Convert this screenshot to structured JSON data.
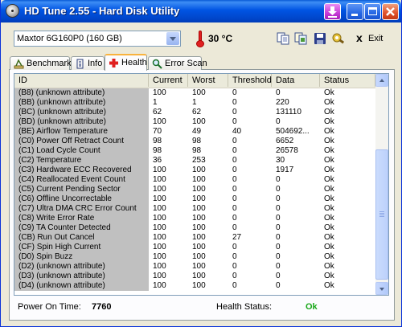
{
  "window": {
    "title": "HD Tune 2.55 - Hard Disk Utility"
  },
  "toolbar": {
    "drive": "Maxtor 6G160P0 (160 GB)",
    "temperature": "30 °C",
    "exit_label": "Exit",
    "exit_mnemonic": "x"
  },
  "tabs": [
    {
      "label": "Benchmark",
      "icon": "benchmark-icon"
    },
    {
      "label": "Info",
      "icon": "info-icon"
    },
    {
      "label": "Health",
      "icon": "health-cross-icon",
      "active": true
    },
    {
      "label": "Error Scan",
      "icon": "magnifier-icon"
    }
  ],
  "grid": {
    "columns": [
      "ID",
      "Current",
      "Worst",
      "Threshold",
      "Data",
      "Status"
    ],
    "rows": [
      {
        "id": "(B8) (unknown attribute)",
        "current": "100",
        "worst": "100",
        "threshold": "0",
        "data": "0",
        "status": "Ok"
      },
      {
        "id": "(BB) (unknown attribute)",
        "current": "1",
        "worst": "1",
        "threshold": "0",
        "data": "220",
        "status": "Ok"
      },
      {
        "id": "(BC) (unknown attribute)",
        "current": "62",
        "worst": "62",
        "threshold": "0",
        "data": "131110",
        "status": "Ok"
      },
      {
        "id": "(BD) (unknown attribute)",
        "current": "100",
        "worst": "100",
        "threshold": "0",
        "data": "0",
        "status": "Ok"
      },
      {
        "id": "(BE) Airflow Temperature",
        "current": "70",
        "worst": "49",
        "threshold": "40",
        "data": "504692...",
        "status": "Ok"
      },
      {
        "id": "(C0) Power Off Retract Count",
        "current": "98",
        "worst": "98",
        "threshold": "0",
        "data": "6652",
        "status": "Ok"
      },
      {
        "id": "(C1) Load Cycle Count",
        "current": "98",
        "worst": "98",
        "threshold": "0",
        "data": "26578",
        "status": "Ok"
      },
      {
        "id": "(C2) Temperature",
        "current": "36",
        "worst": "253",
        "threshold": "0",
        "data": "30",
        "status": "Ok"
      },
      {
        "id": "(C3) Hardware ECC Recovered",
        "current": "100",
        "worst": "100",
        "threshold": "0",
        "data": "1917",
        "status": "Ok"
      },
      {
        "id": "(C4) Reallocated Event Count",
        "current": "100",
        "worst": "100",
        "threshold": "0",
        "data": "0",
        "status": "Ok"
      },
      {
        "id": "(C5) Current Pending Sector",
        "current": "100",
        "worst": "100",
        "threshold": "0",
        "data": "0",
        "status": "Ok"
      },
      {
        "id": "(C6) Offline Uncorrectable",
        "current": "100",
        "worst": "100",
        "threshold": "0",
        "data": "0",
        "status": "Ok"
      },
      {
        "id": "(C7) Ultra DMA CRC Error Count",
        "current": "100",
        "worst": "100",
        "threshold": "0",
        "data": "0",
        "status": "Ok"
      },
      {
        "id": "(C8) Write Error Rate",
        "current": "100",
        "worst": "100",
        "threshold": "0",
        "data": "0",
        "status": "Ok"
      },
      {
        "id": "(C9) TA Counter Detected",
        "current": "100",
        "worst": "100",
        "threshold": "0",
        "data": "0",
        "status": "Ok"
      },
      {
        "id": "(CB) Run Out Cancel",
        "current": "100",
        "worst": "100",
        "threshold": "27",
        "data": "0",
        "status": "Ok"
      },
      {
        "id": "(CF) Spin High Current",
        "current": "100",
        "worst": "100",
        "threshold": "0",
        "data": "0",
        "status": "Ok"
      },
      {
        "id": "(D0) Spin Buzz",
        "current": "100",
        "worst": "100",
        "threshold": "0",
        "data": "0",
        "status": "Ok"
      },
      {
        "id": "(D2) (unknown attribute)",
        "current": "100",
        "worst": "100",
        "threshold": "0",
        "data": "0",
        "status": "Ok"
      },
      {
        "id": "(D3) (unknown attribute)",
        "current": "100",
        "worst": "100",
        "threshold": "0",
        "data": "0",
        "status": "Ok"
      },
      {
        "id": "(D4) (unknown attribute)",
        "current": "100",
        "worst": "100",
        "threshold": "0",
        "data": "0",
        "status": "Ok"
      }
    ]
  },
  "footer": {
    "power_on_label": "Power On Time:",
    "power_on_value": "7760",
    "health_label": "Health Status:",
    "health_value": "Ok",
    "health_color": "#1aa81a"
  }
}
